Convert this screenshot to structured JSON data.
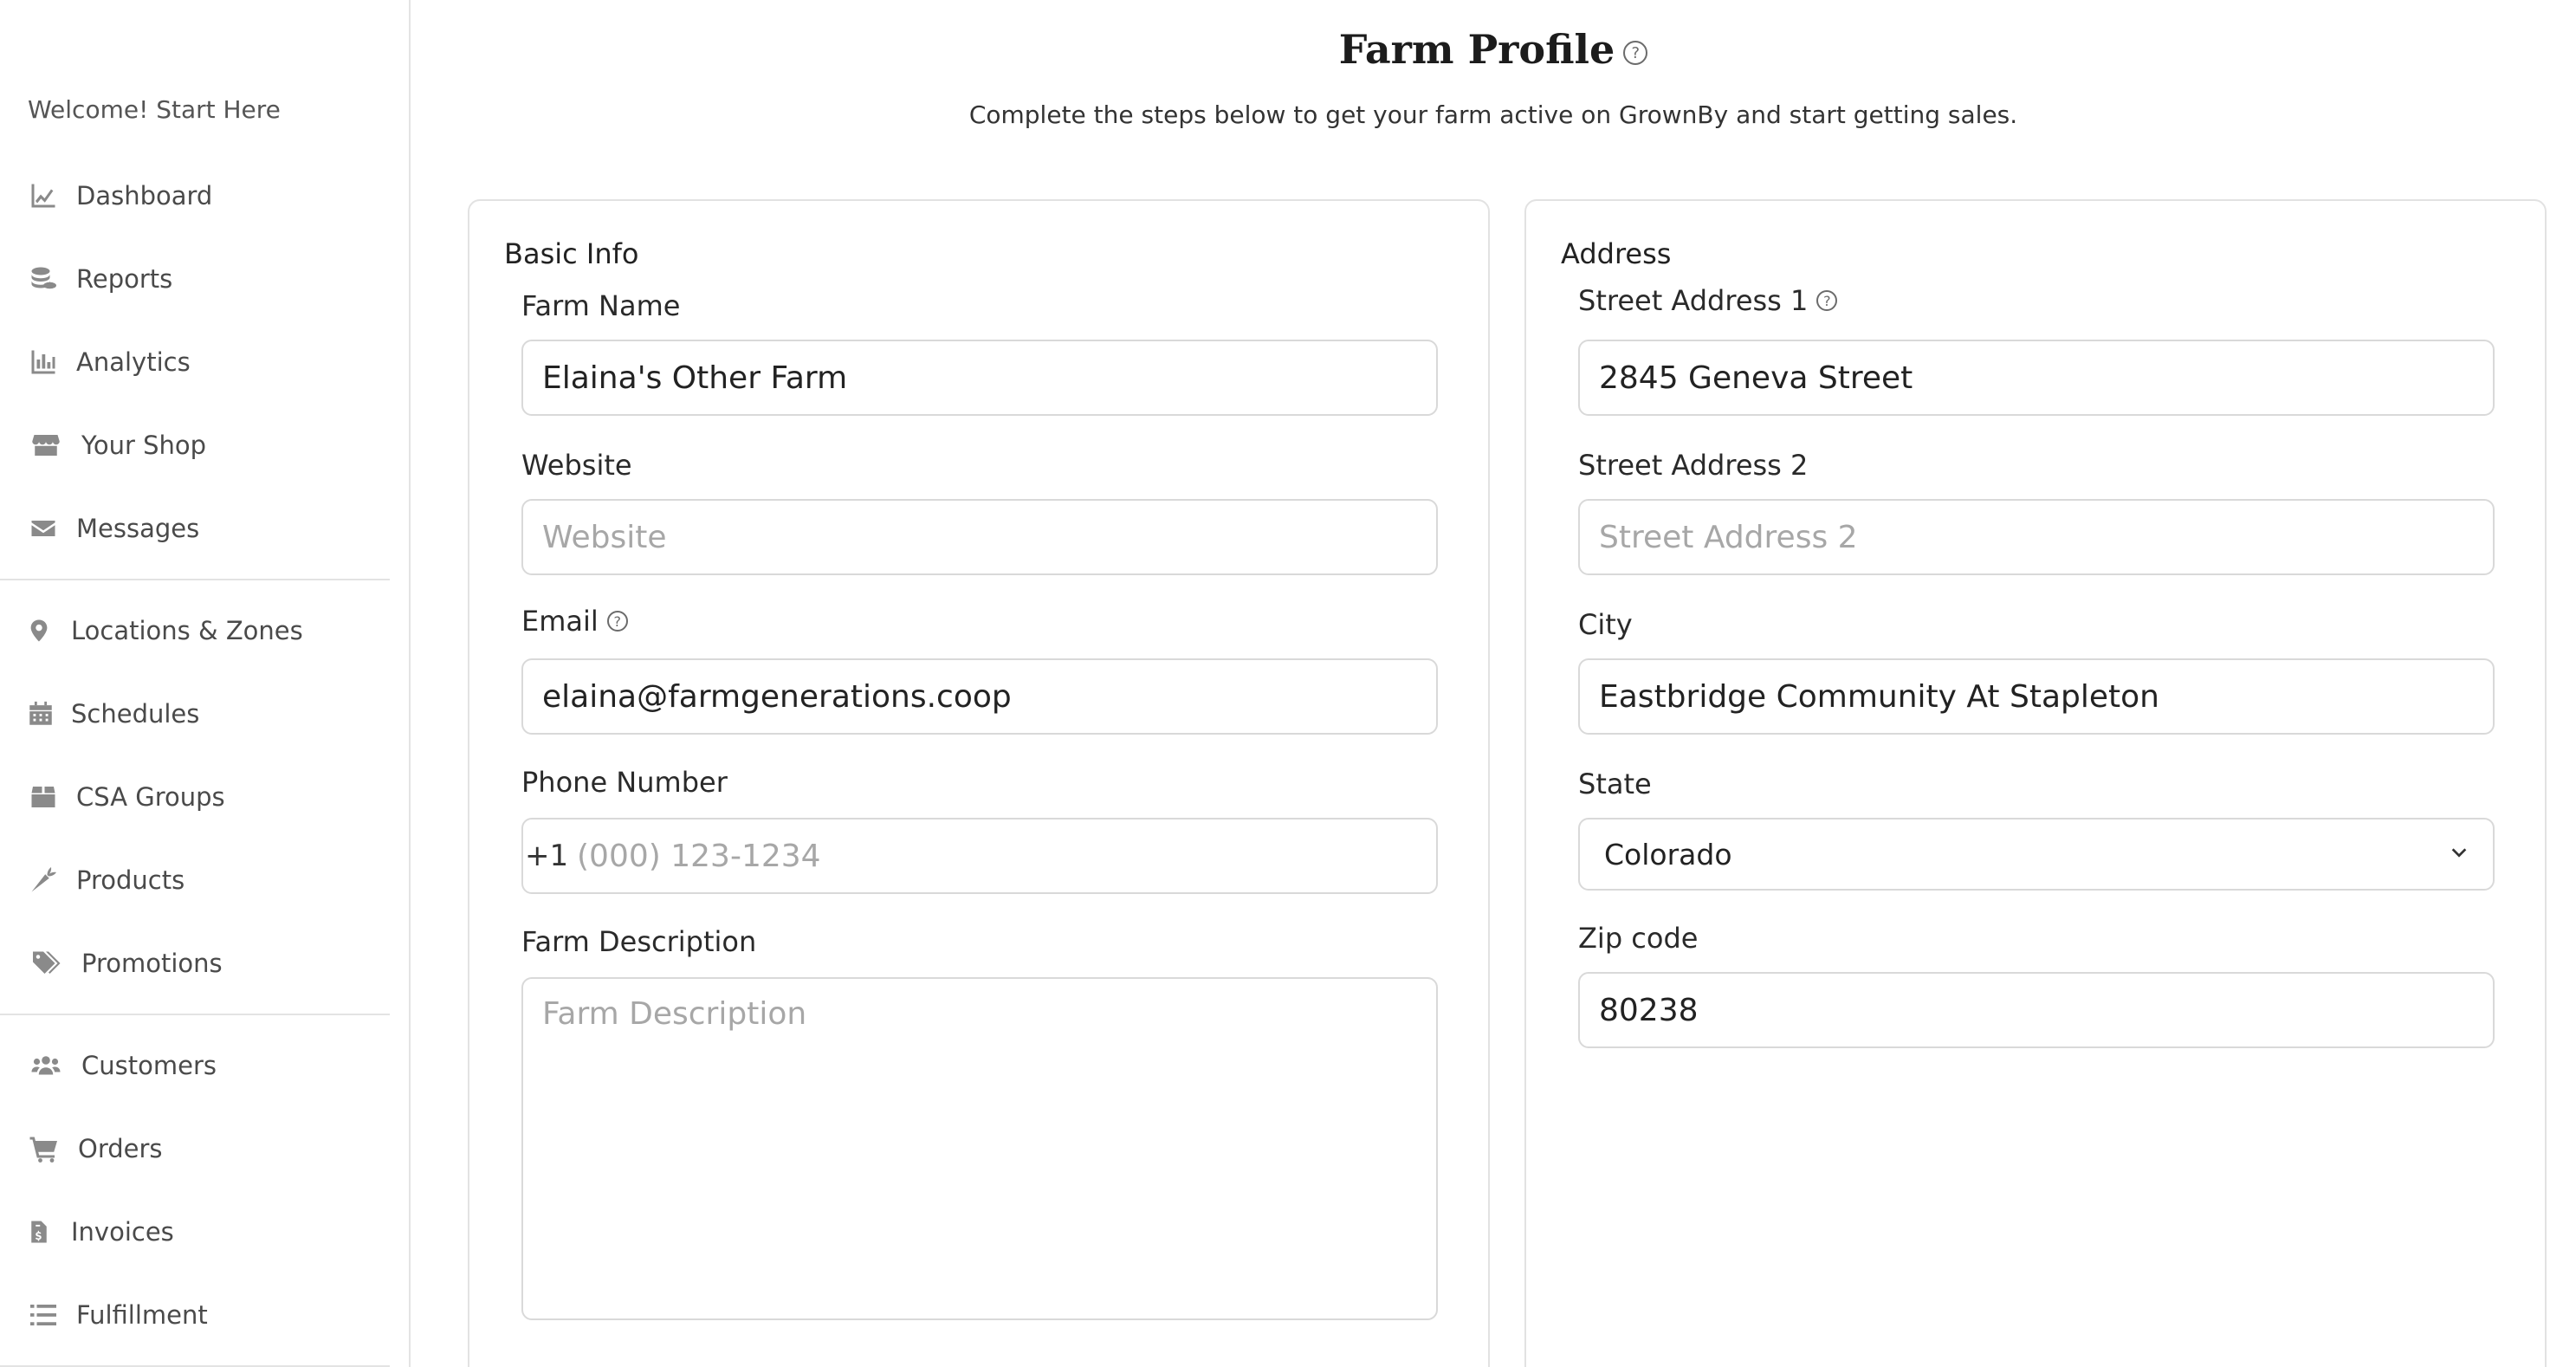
{
  "sidebar": {
    "welcome": "Welcome! Start Here",
    "items": [
      {
        "label": "Dashboard",
        "icon": "chart-line-icon"
      },
      {
        "label": "Reports",
        "icon": "coins-icon"
      },
      {
        "label": "Analytics",
        "icon": "bar-chart-icon"
      },
      {
        "label": "Your Shop",
        "icon": "store-icon"
      },
      {
        "label": "Messages",
        "icon": "envelope-icon"
      },
      {
        "label": "Locations & Zones",
        "icon": "map-pin-icon"
      },
      {
        "label": "Schedules",
        "icon": "calendar-icon"
      },
      {
        "label": "CSA Groups",
        "icon": "box-icon"
      },
      {
        "label": "Products",
        "icon": "carrot-icon"
      },
      {
        "label": "Promotions",
        "icon": "tags-icon"
      },
      {
        "label": "Customers",
        "icon": "users-icon"
      },
      {
        "label": "Orders",
        "icon": "cart-icon"
      },
      {
        "label": "Invoices",
        "icon": "invoice-icon"
      },
      {
        "label": "Fulfillment",
        "icon": "list-icon"
      }
    ]
  },
  "header": {
    "title": "Farm Profile",
    "help_glyph": "?",
    "subtitle": "Complete the steps below to get your farm active on GrownBy and start getting sales."
  },
  "basic_info": {
    "title": "Basic Info",
    "farm_name": {
      "label": "Farm Name",
      "value": "Elaina's Other Farm",
      "placeholder": "Farm Name"
    },
    "website": {
      "label": "Website",
      "value": "",
      "placeholder": "Website"
    },
    "email": {
      "label": "Email",
      "value": "elaina@farmgenerations.coop",
      "placeholder": "Email"
    },
    "phone": {
      "label": "Phone Number",
      "prefix": "+1",
      "value": "",
      "placeholder": "(000) 123-1234"
    },
    "description": {
      "label": "Farm Description",
      "value": "",
      "placeholder": "Farm Description"
    }
  },
  "address": {
    "title": "Address",
    "street1": {
      "label": "Street Address 1",
      "value": "2845 Geneva Street",
      "placeholder": "Street Address 1"
    },
    "street2": {
      "label": "Street Address 2",
      "value": "",
      "placeholder": "Street Address 2"
    },
    "city": {
      "label": "City",
      "value": "Eastbridge Community At Stapleton",
      "placeholder": "City"
    },
    "state": {
      "label": "State",
      "value": "Colorado"
    },
    "zip": {
      "label": "Zip code",
      "value": "80238",
      "placeholder": "Zip code"
    }
  },
  "colors": {
    "icon_gray": "#8a8a8a",
    "border": "#d9d9d9",
    "text": "#222222"
  }
}
